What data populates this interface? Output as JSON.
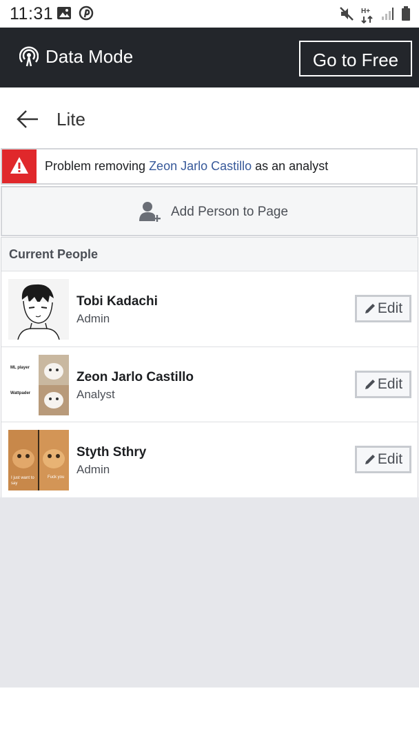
{
  "status_bar": {
    "time": "11:31",
    "network_label": "H+"
  },
  "data_bar": {
    "title": "Data Mode",
    "go_free_label": "Go to Free"
  },
  "header": {
    "title": "Lite"
  },
  "error": {
    "prefix": "Problem removing ",
    "link_name": "Zeon Jarlo Castillo",
    "suffix": " as an analyst"
  },
  "add_person": {
    "label": "Add Person to Page"
  },
  "people": {
    "header": "Current People",
    "list": [
      {
        "name": "Tobi Kadachi",
        "role": "Admin",
        "edit_label": "Edit"
      },
      {
        "name": "Zeon Jarlo Castillo",
        "role": "Analyst",
        "edit_label": "Edit",
        "avatar_captions": [
          "ML player",
          "Wattpader"
        ]
      },
      {
        "name": "Styth Sthry",
        "role": "Admin",
        "edit_label": "Edit",
        "avatar_captions": [
          "I just want to say",
          "Fuck you"
        ]
      }
    ]
  },
  "colors": {
    "data_bar_bg": "#23262b",
    "error_red": "#e0282b",
    "link_blue": "#365899"
  }
}
